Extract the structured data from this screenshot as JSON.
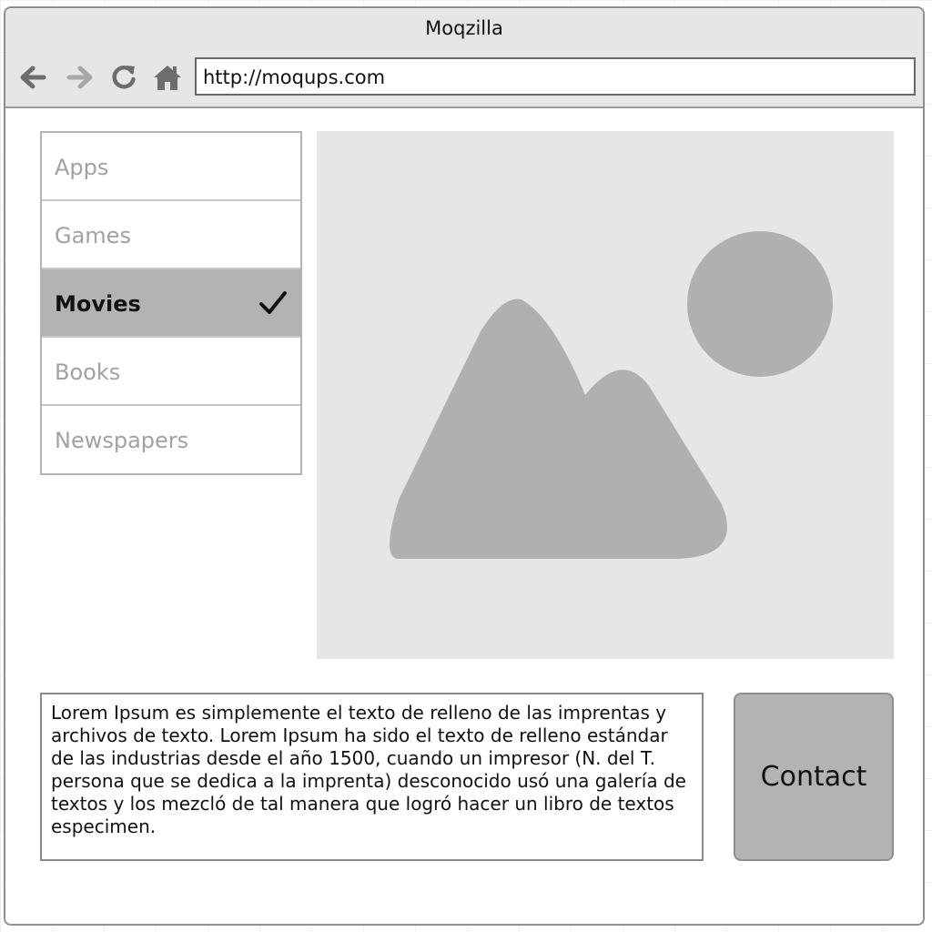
{
  "window": {
    "title": "Moqzilla"
  },
  "toolbar": {
    "back_icon": "arrow-left-icon",
    "forward_icon": "arrow-right-icon",
    "reload_icon": "reload-icon",
    "home_icon": "home-icon",
    "url": "http://moqups.com"
  },
  "sidebar": {
    "items": [
      {
        "label": "Apps",
        "selected": false
      },
      {
        "label": "Games",
        "selected": false
      },
      {
        "label": "Movies",
        "selected": true
      },
      {
        "label": "Books",
        "selected": false
      },
      {
        "label": "Newspapers",
        "selected": false
      }
    ]
  },
  "main": {
    "image_icon": "image-placeholder-icon",
    "paragraph": "Lorem Ipsum es simplemente el texto de relleno de las imprentas y archivos de texto. Lorem Ipsum ha sido el texto de relleno estándar de las industrias desde el año 1500, cuando un impresor (N. del T. persona que se dedica a la imprenta) desconocido usó una galería de textos y los mezcló de tal manera que logró hacer un libro de textos especimen.",
    "contact_label": "Contact"
  },
  "colors": {
    "titlebar_bg": "#e6e6e6",
    "selected_item_bg": "#b3b3b3",
    "image_bg": "#e6e6e6",
    "image_shape": "#b0b0b0",
    "button_bg": "#b3b3b3"
  }
}
